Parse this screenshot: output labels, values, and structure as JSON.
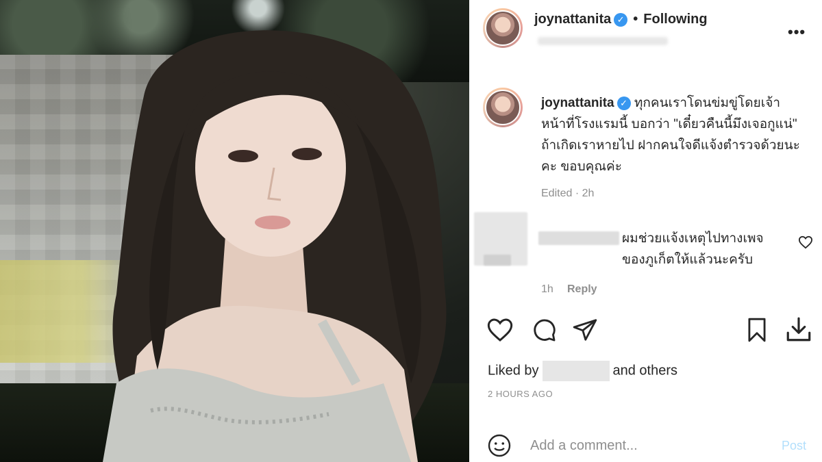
{
  "post": {
    "username": "joynattanita",
    "verified_badge": "verified-icon",
    "separator": "•",
    "follow_status": "Following",
    "more_icon": "more-options-icon"
  },
  "caption": {
    "username": "joynattanita",
    "text": "ทุกคนเราโดนข่มขู่โดยเจ้าหน้าที่โรงแรมนี้ บอกว่า \"เดี๋ยวคืนนี้มึงเจอกูแน่\" ถ้าเกิดเราหายไป ฝากคนใจดีแจ้งตำรวจด้วยนะคะ ขอบคุณค่ะ",
    "meta": "Edited · 2h"
  },
  "comment": {
    "text_suffix": "ผมช่วยแจ้งเหตุไปทางเพจของภูเก็ตให้แล้วนะครับ",
    "time": "1h",
    "reply": "Reply"
  },
  "actions": {
    "icons": [
      "heart-icon",
      "comment-icon",
      "share-icon",
      "bookmark-icon",
      "download-icon"
    ]
  },
  "likes": {
    "prefix": "Liked by",
    "suffix": "and others"
  },
  "timestamp": "2 HOURS AGO",
  "add_comment": {
    "placeholder": "Add a comment...",
    "post_label": "Post"
  },
  "colors": {
    "verified": "#3897f0",
    "post_button": "#b2dffc",
    "secondary_text": "#8e8e8e"
  }
}
